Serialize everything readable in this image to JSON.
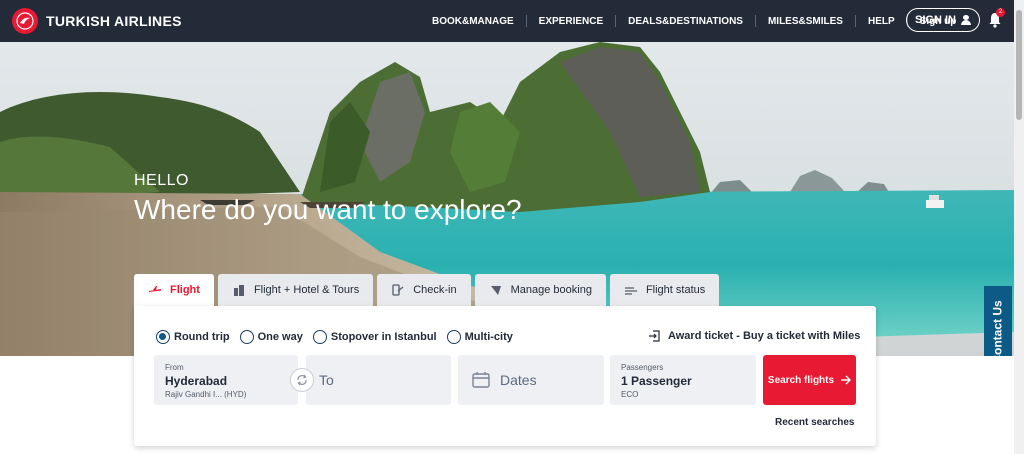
{
  "header": {
    "brand": "TURKISH AIRLINES",
    "nav": [
      "BOOK&MANAGE",
      "EXPERIENCE",
      "DEALS&DESTINATIONS",
      "MILES&SMILES",
      "HELP",
      "Sign up"
    ],
    "sign_in": "SIGN IN",
    "notification_count": "2"
  },
  "hero": {
    "greeting": "HELLO",
    "headline": "Where do you want to explore?"
  },
  "contact_tab": "Contact Us",
  "booking": {
    "tabs": [
      {
        "label": "Flight",
        "icon": "plane-icon",
        "active": true
      },
      {
        "label": "Flight + Hotel & Tours",
        "icon": "building-icon",
        "active": false
      },
      {
        "label": "Check-in",
        "icon": "checkin-icon",
        "active": false
      },
      {
        "label": "Manage booking",
        "icon": "ticket-icon",
        "active": false
      },
      {
        "label": "Flight status",
        "icon": "flight-status-icon",
        "active": false
      }
    ],
    "trip_types": [
      {
        "label": "Round trip",
        "checked": true
      },
      {
        "label": "One way",
        "checked": false
      },
      {
        "label": "Stopover in Istanbul",
        "checked": false
      },
      {
        "label": "Multi-city",
        "checked": false
      }
    ],
    "award_ticket": "Award ticket - Buy a ticket with Miles",
    "from": {
      "label": "From",
      "city": "Hyderabad",
      "airport": "Rajiv Gandhi I...  (HYD)"
    },
    "to": {
      "placeholder": "To"
    },
    "dates": {
      "placeholder": "Dates"
    },
    "passengers": {
      "label": "Passengers",
      "value": "1 Passenger",
      "cabin": "ECO"
    },
    "search_button": "Search flights",
    "recent_searches": "Recent searches"
  },
  "colors": {
    "brand_red": "#e81932",
    "header_bg": "#232b38",
    "contact_blue": "#0e5a86"
  }
}
